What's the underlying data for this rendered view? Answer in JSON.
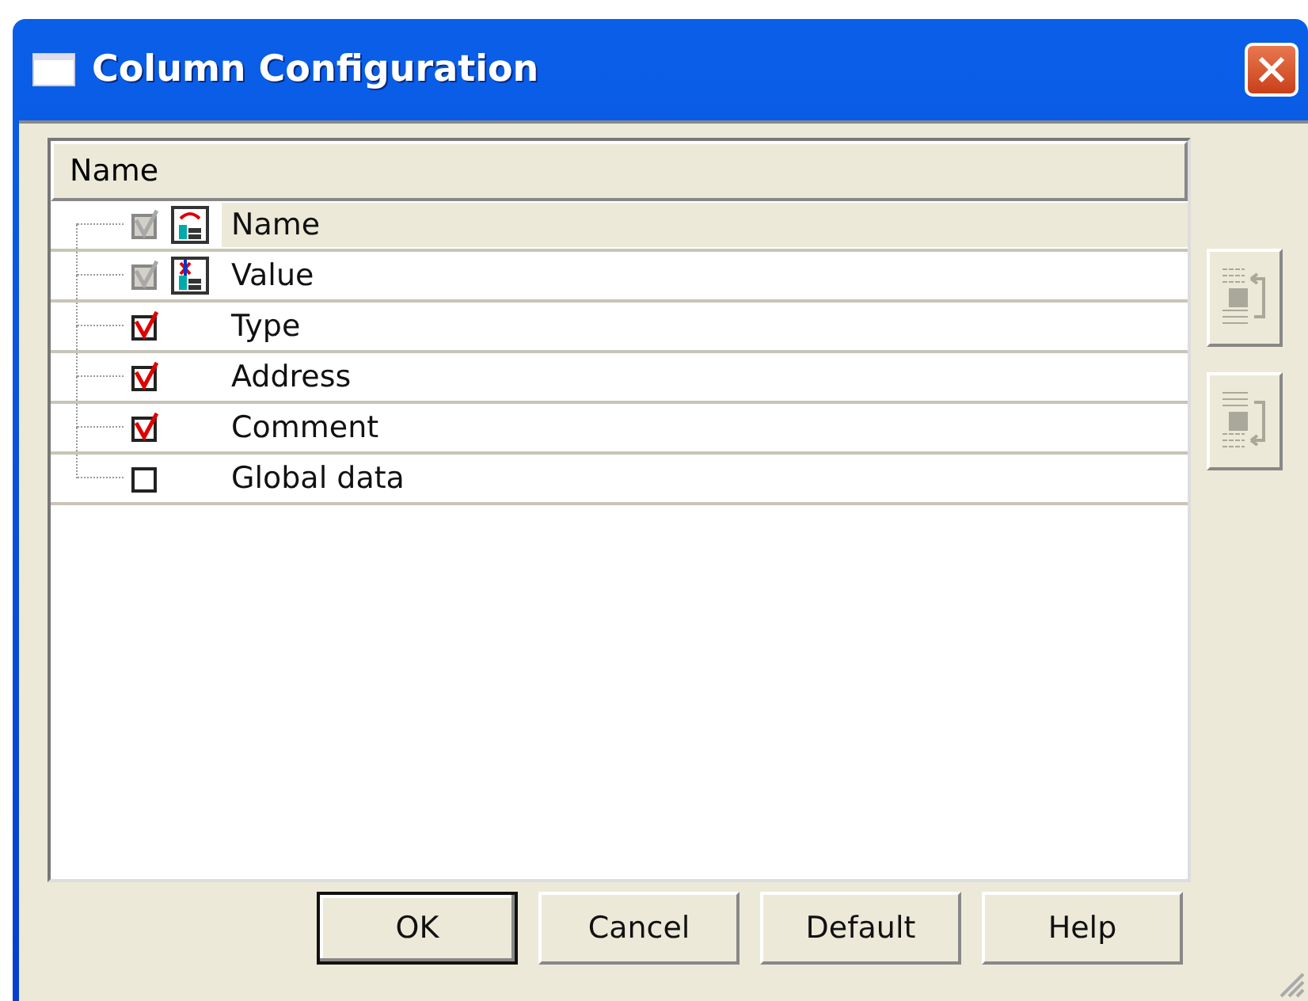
{
  "window": {
    "title": "Column Configuration"
  },
  "list": {
    "header": "Name",
    "rows": [
      {
        "label": "Name",
        "kind": "fixed",
        "checked": true,
        "disabled": true,
        "selected": true
      },
      {
        "label": "Value",
        "kind": "fixed",
        "checked": true,
        "disabled": true,
        "selected": false
      },
      {
        "label": "Type",
        "kind": "option",
        "checked": true,
        "disabled": false,
        "selected": false
      },
      {
        "label": "Address",
        "kind": "option",
        "checked": true,
        "disabled": false,
        "selected": false
      },
      {
        "label": "Comment",
        "kind": "option",
        "checked": true,
        "disabled": false,
        "selected": false
      },
      {
        "label": "Global data",
        "kind": "option",
        "checked": false,
        "disabled": false,
        "selected": false
      }
    ]
  },
  "side_buttons": [
    {
      "kind": "up",
      "disabled": true
    },
    {
      "kind": "down",
      "disabled": true
    }
  ],
  "buttons": [
    {
      "label": "OK",
      "default": true
    },
    {
      "label": "Cancel",
      "default": false
    },
    {
      "label": "Default",
      "default": false
    },
    {
      "label": "Help",
      "default": false
    }
  ]
}
